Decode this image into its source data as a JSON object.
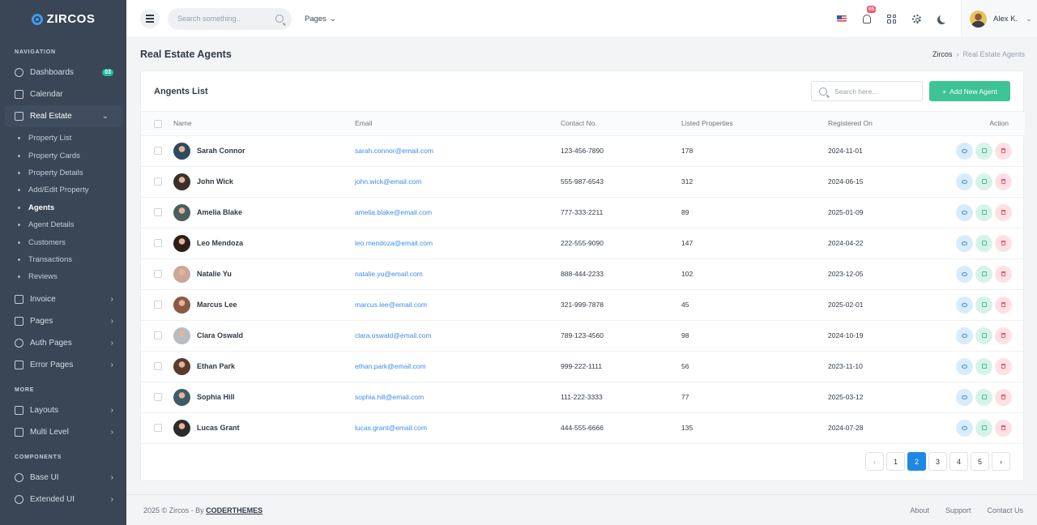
{
  "brand": {
    "name": "ZIRCOS"
  },
  "sidebar": {
    "section_navigation": "Navigation",
    "section_more": "More",
    "section_components": "Components",
    "dashboards": {
      "label": "Dashboards",
      "badge": "03"
    },
    "calendar": {
      "label": "Calendar"
    },
    "real_estate": {
      "label": "Real Estate"
    },
    "sub": [
      "Property List",
      "Property Cards",
      "Property Details",
      "Add/Edit Property",
      "Agents",
      "Agent Details",
      "Customers",
      "Transactions",
      "Reviews"
    ],
    "invoice": "Invoice",
    "pages": "Pages",
    "auth_pages": "Auth Pages",
    "error_pages": "Error Pages",
    "layouts": "Layouts",
    "multi_level": "Multi Level",
    "base_ui": "Base UI",
    "extended_ui": "Extended UI"
  },
  "topbar": {
    "search_placeholder": "Search something..",
    "pages_menu": "Pages",
    "notification_count": "05",
    "user_name": "Alex K."
  },
  "page": {
    "title": "Real Estate Agents",
    "breadcrumb_root": "Zircos",
    "breadcrumb_current": "Real Estate Agents"
  },
  "card": {
    "title": "Angents List",
    "search_placeholder": "Search here...",
    "add_button": "Add New Agent"
  },
  "table": {
    "headers": [
      "Name",
      "Email",
      "Contact No.",
      "Listed Properties",
      "Registered On",
      "Action"
    ],
    "rows": [
      {
        "name": "Sarah Connor",
        "email": "sarah.connor@email.com",
        "contact": "123-456-7890",
        "listed": "178",
        "registered": "2024-11-01",
        "avatar_color": "#2f4a5c"
      },
      {
        "name": "John Wick",
        "email": "john.wick@email.com",
        "contact": "555-987-6543",
        "listed": "312",
        "registered": "2024-06-15",
        "avatar_color": "#3b2f2a"
      },
      {
        "name": "Amelia Blake",
        "email": "amelia.blake@email.com",
        "contact": "777-333-2211",
        "listed": "89",
        "registered": "2025-01-09",
        "avatar_color": "#4b5d5e"
      },
      {
        "name": "Leo Mendoza",
        "email": "leo.mendoza@email.com",
        "contact": "222-555-9090",
        "listed": "147",
        "registered": "2024-04-22",
        "avatar_color": "#2e1e1a"
      },
      {
        "name": "Natalie Yu",
        "email": "natalie.yu@email.com",
        "contact": "888-444-2233",
        "listed": "102",
        "registered": "2023-12-05",
        "avatar_color": "#c9a89a"
      },
      {
        "name": "Marcus Lee",
        "email": "marcus.lee@email.com",
        "contact": "321-999-7878",
        "listed": "45",
        "registered": "2025-02-01",
        "avatar_color": "#8a5a44"
      },
      {
        "name": "Clara Oswald",
        "email": "clara.oswald@email.com",
        "contact": "789-123-4560",
        "listed": "98",
        "registered": "2024-10-19",
        "avatar_color": "#b9bcc0"
      },
      {
        "name": "Ethan Park",
        "email": "ethan.park@email.com",
        "contact": "999-222-1111",
        "listed": "56",
        "registered": "2023-11-10",
        "avatar_color": "#5a3a2c"
      },
      {
        "name": "Sophia Hill",
        "email": "sophia.hill@email.com",
        "contact": "111-222-3333",
        "listed": "77",
        "registered": "2025-03-12",
        "avatar_color": "#3e5a66"
      },
      {
        "name": "Lucas Grant",
        "email": "lucas.grant@email.com",
        "contact": "444-555-6666",
        "listed": "135",
        "registered": "2024-07-28",
        "avatar_color": "#2b2b2b"
      }
    ]
  },
  "pagination": {
    "prev": "‹",
    "next": "›",
    "pages": [
      "1",
      "2",
      "3",
      "4",
      "5"
    ],
    "current": "2"
  },
  "footer": {
    "copyright": "2025 © Zircos - By ",
    "brand": "CODERTHEMES",
    "links": [
      "About",
      "Support",
      "Contact Us"
    ]
  }
}
